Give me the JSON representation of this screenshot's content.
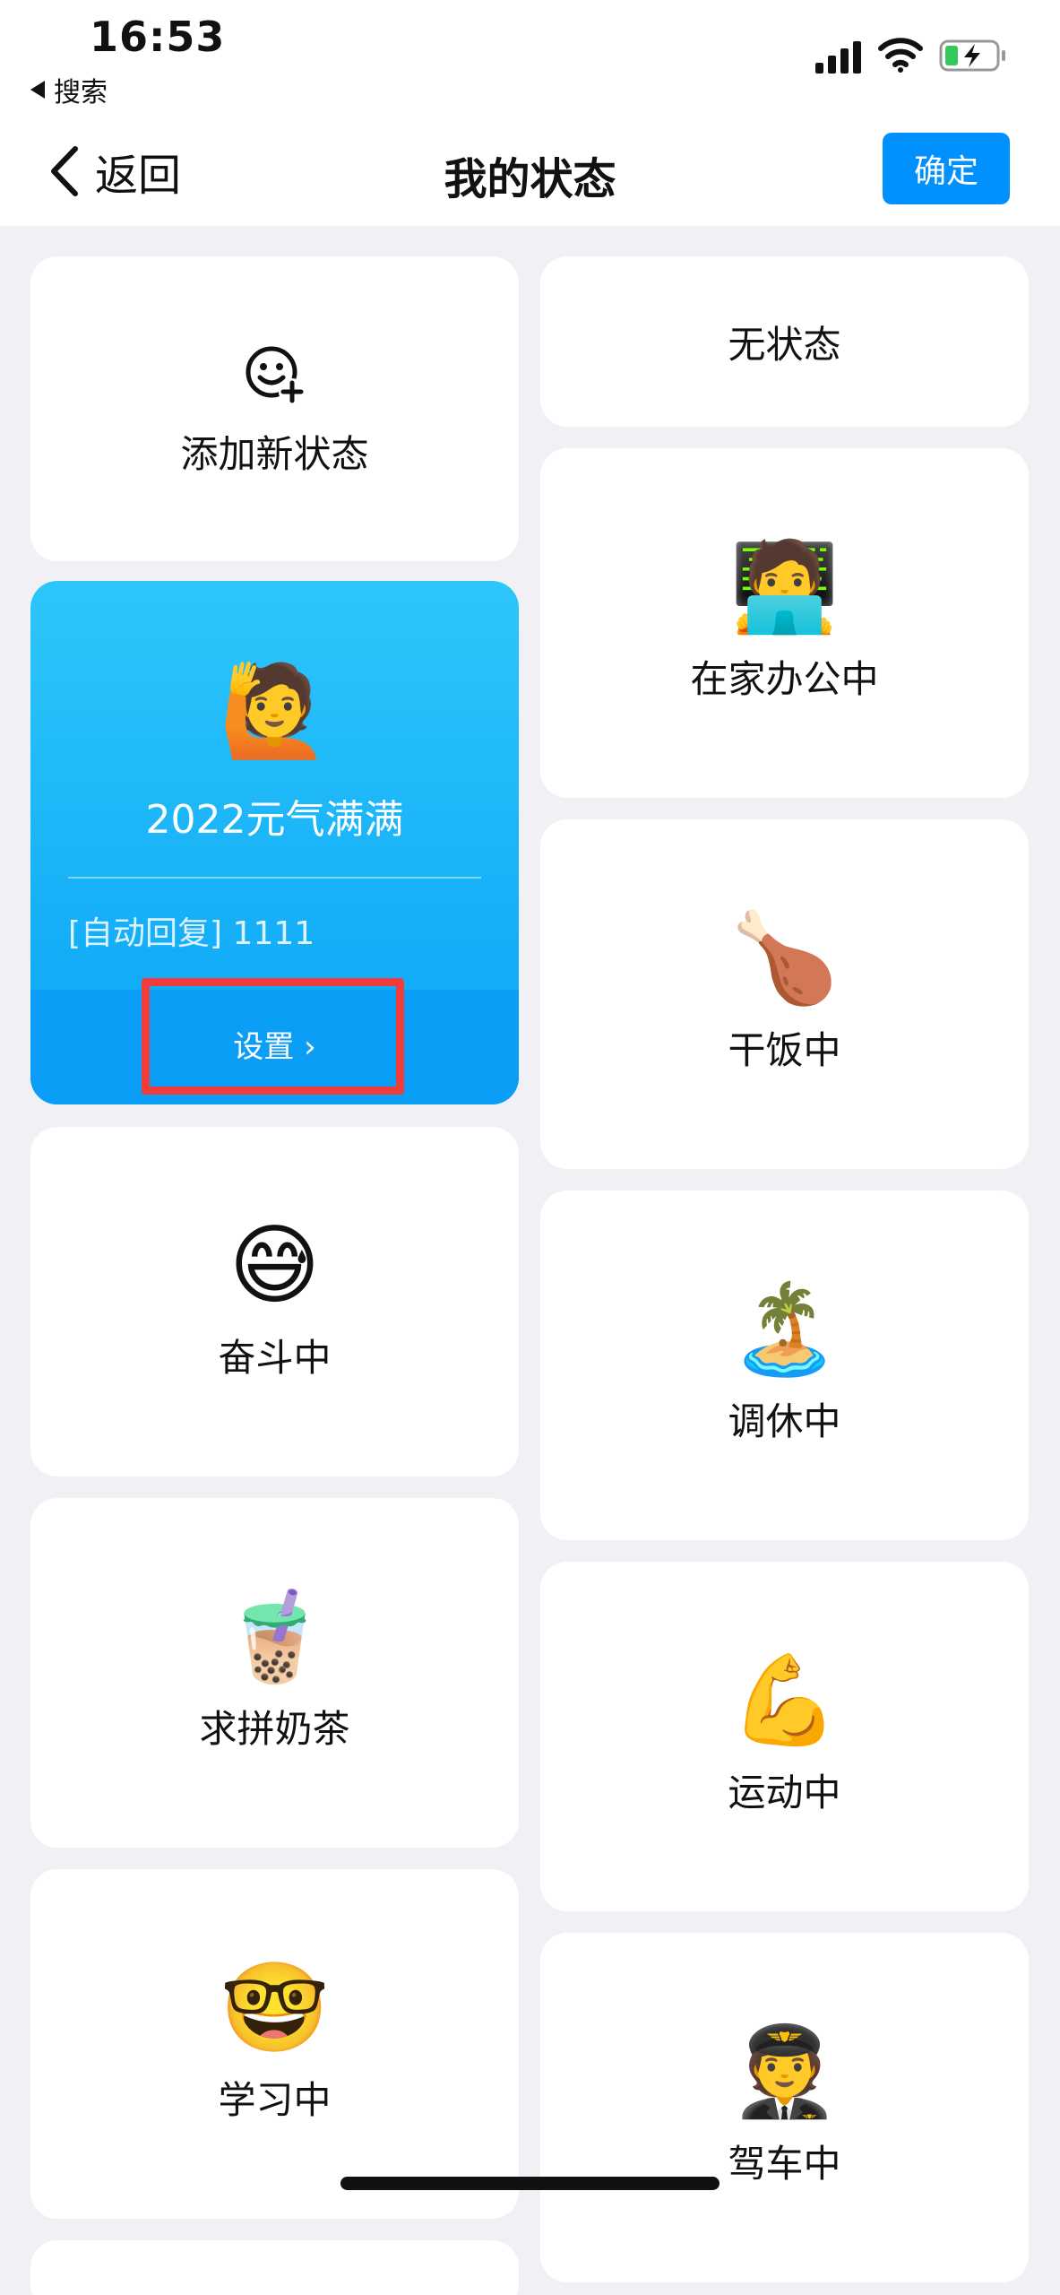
{
  "status_bar": {
    "time": "16:53",
    "back_app_label": "搜索",
    "icons": [
      "signal-icon",
      "wifi-icon",
      "battery-charging-icon"
    ]
  },
  "nav": {
    "back_label": "返回",
    "title": "我的状态",
    "confirm_label": "确定"
  },
  "colors": {
    "accent": "#0091ff",
    "selected_gradient_top": "#2dc6fb",
    "selected_gradient_bottom": "#0aa4f6",
    "highlight_red": "#f23b3b",
    "background": "#f0f0f5"
  },
  "left_column": {
    "add_status_label": "添加新状态",
    "selected": {
      "emoji": "🙋",
      "title": "2022元气满满",
      "auto_reply": "[自动回复] 1111",
      "settings_label": "设置 ›"
    },
    "items": [
      {
        "emoji": "😅",
        "label": "奋斗中"
      },
      {
        "emoji": "🧋",
        "label": "求拼奶茶"
      },
      {
        "emoji": "🤓",
        "label": "学习中"
      }
    ]
  },
  "right_column": {
    "items": [
      {
        "emoji": "",
        "label": "无状态"
      },
      {
        "emoji": "🧑‍💻",
        "label": "在家办公中"
      },
      {
        "emoji": "🍗",
        "label": "干饭中"
      },
      {
        "emoji": "🏝️",
        "label": "调休中"
      },
      {
        "emoji": "💪",
        "label": "运动中"
      },
      {
        "emoji": "🧑‍✈️",
        "label": "驾车中"
      }
    ]
  }
}
